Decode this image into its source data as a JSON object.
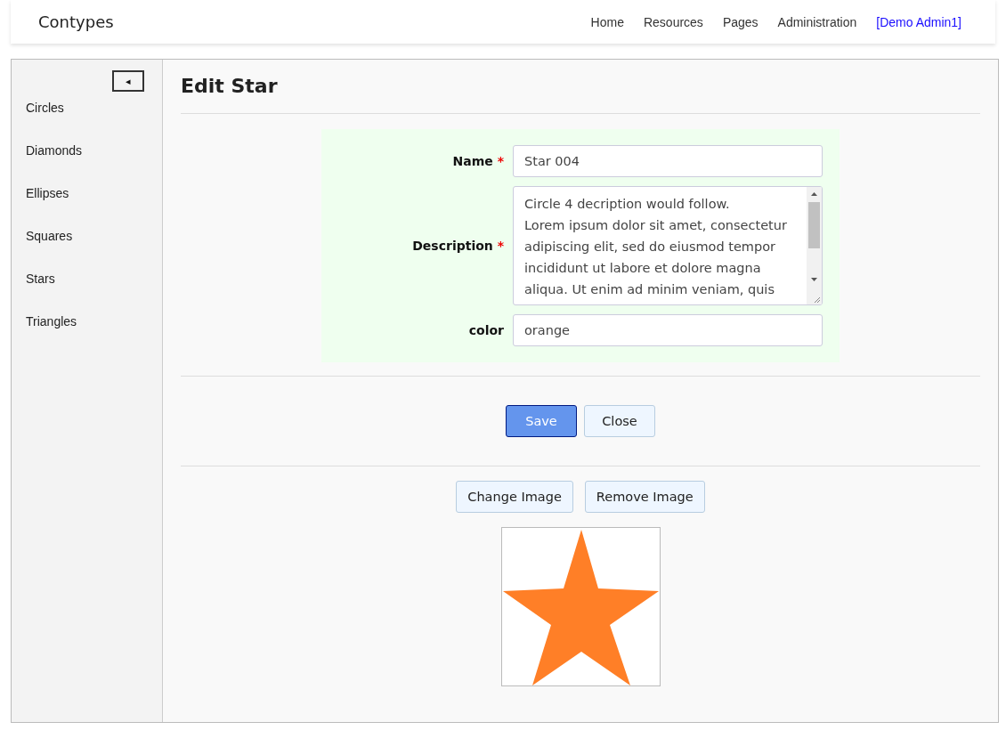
{
  "brand": "Contypes",
  "nav": [
    {
      "label": "Home",
      "kind": "link"
    },
    {
      "label": "Resources",
      "kind": "link"
    },
    {
      "label": "Pages",
      "kind": "link"
    },
    {
      "label": "Administration",
      "kind": "link"
    },
    {
      "label": "[Demo Admin1]",
      "kind": "user"
    }
  ],
  "sidebar": {
    "collapse_button": "◂",
    "items": [
      "Circles",
      "Diamonds",
      "Ellipses",
      "Squares",
      "Stars",
      "Triangles"
    ]
  },
  "title": "Edit Star",
  "form": {
    "fields": [
      {
        "label": "Name",
        "required_mark": "*",
        "kind": "input",
        "value": "Star 004"
      },
      {
        "label": "Description",
        "required_mark": "*",
        "kind": "textarea",
        "value": "Circle 4 decription would follow.\nLorem ipsum dolor sit amet, consectetur adipiscing elit, sed do eiusmod tempor incididunt ut labore et dolore magna aliqua. Ut enim ad minim veniam, quis"
      },
      {
        "label": "color",
        "kind": "input",
        "value": "orange"
      }
    ]
  },
  "actions": [
    {
      "label": "Save",
      "kind": "primary"
    },
    {
      "label": "Close",
      "kind": "secondary"
    }
  ],
  "image_actions": [
    {
      "label": "Change Image"
    },
    {
      "label": "Remove Image"
    }
  ]
}
